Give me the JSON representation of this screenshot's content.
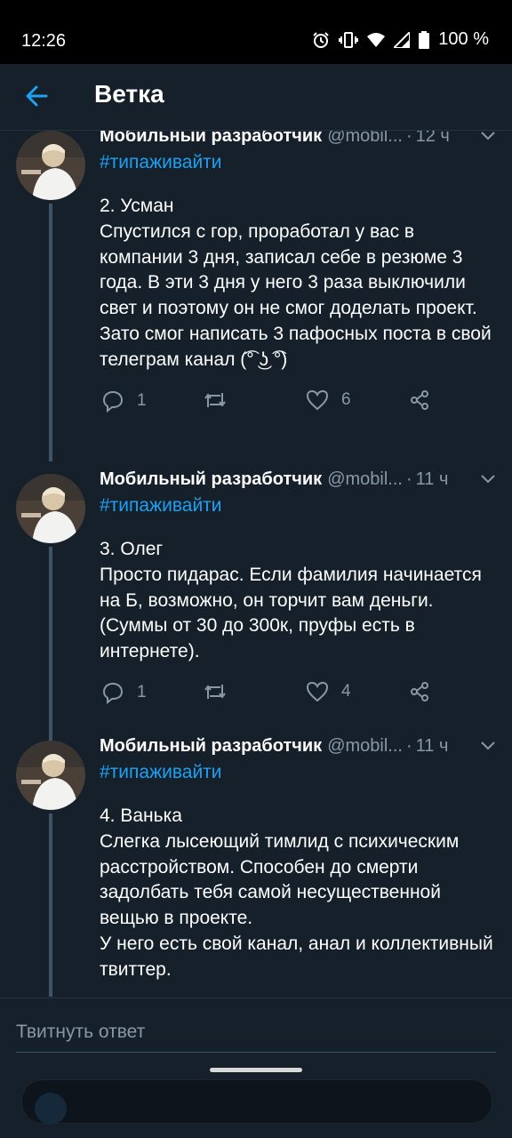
{
  "status": {
    "time": "12:26",
    "battery": "100 %"
  },
  "header": {
    "title": "Ветка"
  },
  "tweets": [
    {
      "name": "Мобильный разработчик",
      "handle": "@mobil...",
      "time": "12 ч",
      "hashtag": "#типаживайти",
      "text": "2. Усман\nСпустился с гор, проработал у вас в компании 3 дня, записал себе в резюме 3 года. В эти 3 дня у него 3 раза выключили свет и поэтому он не смог доделать проект.\nЗато смог написать 3 пафосных поста в свой телеграм канал (͡° ͜ʖ ͡°)",
      "replies": "1",
      "retweets": "",
      "likes": "6"
    },
    {
      "name": "Мобильный разработчик",
      "handle": "@mobil...",
      "time": "11 ч",
      "hashtag": "#типаживайти",
      "text": "3. Олег\nПросто пидарас. Если фамилия начинается на Б, возможно, он торчит вам деньги. (Суммы от 30 до 300к, пруфы есть в интернете).",
      "replies": "1",
      "retweets": "",
      "likes": "4"
    },
    {
      "name": "Мобильный разработчик",
      "handle": "@mobil...",
      "time": "11 ч",
      "hashtag": "#типаживайти",
      "text": "4. Ванька\nСлегка лысеющий тимлид с психическим расстройством. Способен до смерти задолбать тебя самой несущественной вещью в проекте.\nУ него есть свой канал, анал и коллективный твиттер."
    }
  ],
  "reply": {
    "placeholder": "Твитнуть ответ"
  },
  "colors": {
    "background": "#15202b",
    "accent": "#1da1f2",
    "secondary_text": "#8899a6",
    "thread_line": "#3d5466"
  }
}
